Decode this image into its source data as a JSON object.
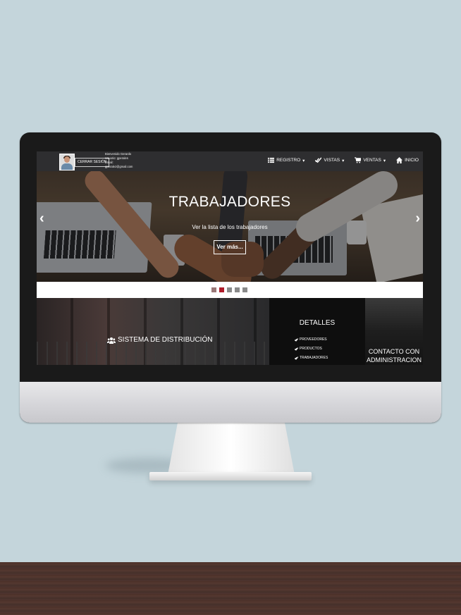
{
  "navbar": {
    "logout_label": "CERRAR SESIÓN",
    "user_lines": [
      "Bienvenido Gerardo",
      "Usuario: gperales",
      "Email:",
      "gperalez@gmail.com"
    ],
    "menu": [
      {
        "label": "REGISTRO",
        "icon": "list-icon",
        "dropdown": true
      },
      {
        "label": "VISTAS",
        "icon": "check-double-icon",
        "dropdown": true
      },
      {
        "label": "VENTAS",
        "icon": "cart-icon",
        "dropdown": true
      },
      {
        "label": "INICIO",
        "icon": "home-icon",
        "dropdown": false
      }
    ]
  },
  "carousel": {
    "title": "TRABAJADORES",
    "subtitle": "Ver la lista de los trabajadores",
    "button_label": "Ver más...",
    "prev_icon": "chevron-left-icon",
    "next_icon": "chevron-right-icon",
    "indicator_count": 5,
    "active_indicator": 2
  },
  "panels": {
    "sistema_label": "SISTEMA DE DISTRIBUCIÓN",
    "detalles_title": "DETALLES",
    "detalles_items": [
      "PROVEEDORES",
      "PRODUCTOS",
      "TRABAJADORES"
    ],
    "contacto_line1": "CONTACTO CON",
    "contacto_line2": "ADMINISTRACION"
  },
  "colors": {
    "navbar_bg": "#2e2e30",
    "accent_indicator": "#b01d2a",
    "background": "#c4d5db"
  }
}
